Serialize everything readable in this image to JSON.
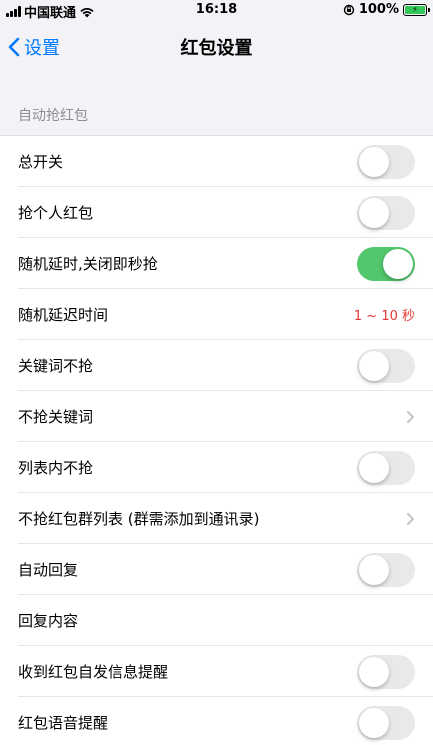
{
  "status_bar": {
    "carrier": "中国联通",
    "time": "16:18",
    "battery": "100%"
  },
  "nav": {
    "back_label": "设置",
    "title": "红包设置"
  },
  "section": {
    "header": "自动抢红包"
  },
  "rows": [
    {
      "label": "总开关",
      "type": "toggle",
      "on": false
    },
    {
      "label": "抢个人红包",
      "type": "toggle",
      "on": false
    },
    {
      "label": "随机延时,关闭即秒抢",
      "type": "toggle",
      "on": true
    },
    {
      "label": "随机延迟时间",
      "type": "value",
      "value": "1 ~ 10 秒"
    },
    {
      "label": "关键词不抢",
      "type": "toggle",
      "on": false
    },
    {
      "label": "不抢关键词",
      "type": "chevron"
    },
    {
      "label": "列表内不抢",
      "type": "toggle",
      "on": false
    },
    {
      "label": "不抢红包群列表 (群需添加到通讯录)",
      "type": "chevron"
    },
    {
      "label": "自动回复",
      "type": "toggle",
      "on": false
    },
    {
      "label": "回复内容",
      "type": "none"
    },
    {
      "label": "收到红包自发信息提醒",
      "type": "toggle",
      "on": false
    },
    {
      "label": "红包语音提醒",
      "type": "toggle",
      "on": false
    }
  ],
  "colors": {
    "accent": "#007aff",
    "toggle_on": "#53c76b",
    "value_red": "#e53935",
    "group_background": "#f2f2f7"
  }
}
